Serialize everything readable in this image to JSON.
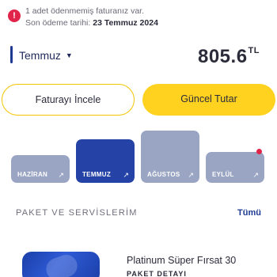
{
  "alert": {
    "icon": "exclamation-icon",
    "line1": "1 adet ödenmemiş faturanız var.",
    "due_label": "Son ödeme tarihi:",
    "due_date": "23 Temmuz 2024",
    "color": "#e0244a"
  },
  "period": {
    "selected_month": "Temmuz",
    "amount": "805.6",
    "currency": "TL"
  },
  "actions": {
    "view_invoice_label": "Faturayı İncele",
    "current_amount_label": "Güncel Tutar"
  },
  "bill_chart": {
    "months": [
      {
        "label": "HAZİRAN",
        "arrow": "↗",
        "level": 0.3,
        "color": "#9aa5c4",
        "alert": false
      },
      {
        "label": "TEMMUZ",
        "arrow": "↗",
        "level": 0.74,
        "color": "#2543a6",
        "alert": false
      },
      {
        "label": "AĞUSTOS",
        "arrow": "↗",
        "level": 1.0,
        "color": "#9aa5c4",
        "alert": false
      },
      {
        "label": "EYLÜL",
        "arrow": "↗",
        "level": 0.38,
        "color": "#9aa5c4",
        "alert": true
      }
    ]
  },
  "packages": {
    "title": "PAKET VE SERVİSLERİM",
    "all_link": "Tümü",
    "items": [
      {
        "name": "Platinum Süper Fırsat 30",
        "type": "PAKET DETAYI"
      }
    ]
  }
}
